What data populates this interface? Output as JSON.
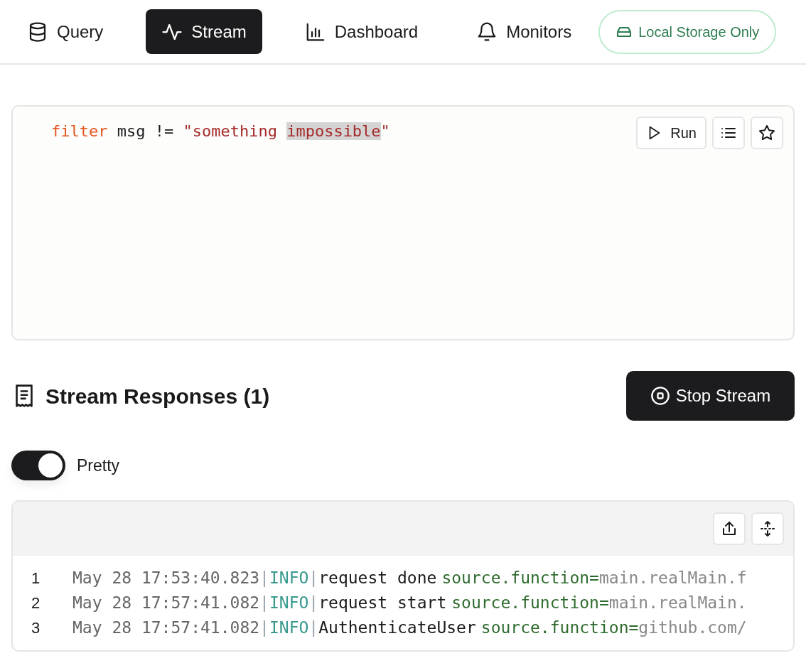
{
  "nav": {
    "tabs": [
      {
        "label": "Query",
        "kind": "database",
        "selected": false
      },
      {
        "label": "Stream",
        "kind": "pulse",
        "selected": true
      },
      {
        "label": "Dashboard",
        "kind": "chart",
        "selected": false
      },
      {
        "label": "Monitors",
        "kind": "bell",
        "selected": false
      }
    ],
    "storage_badge": "Local Storage Only"
  },
  "editor": {
    "tokens": [
      {
        "text": "filter",
        "kind": "keyword",
        "highlighted": false
      },
      {
        "text": " msg != ",
        "kind": "plain",
        "highlighted": false
      },
      {
        "text": "\"something ",
        "kind": "string",
        "highlighted": false
      },
      {
        "text": "impossible",
        "kind": "string",
        "highlighted": true
      },
      {
        "text": "\"",
        "kind": "string",
        "highlighted": false
      }
    ],
    "run_button": "Run"
  },
  "responses": {
    "title": "Stream Responses (1)",
    "stop_button": "Stop Stream",
    "pretty_toggle": {
      "label": "Pretty",
      "on": true
    }
  },
  "log": {
    "lines": [
      {
        "number": "1",
        "timestamp": "May 28 17:53:40.823",
        "separator_1": "|",
        "level": "INFO",
        "separator_2": "|",
        "message": "request done",
        "field_key": "source.function=",
        "field_value": "main.realMain.f"
      },
      {
        "number": "2",
        "timestamp": "May 28 17:57:41.082",
        "separator_1": "|",
        "level": "INFO",
        "separator_2": "|",
        "message": "request start",
        "field_key": "source.function=",
        "field_value": "main.realMain."
      },
      {
        "number": "3",
        "timestamp": "May 28 17:57:41.082",
        "separator_1": "|",
        "level": "INFO",
        "separator_2": "|",
        "message": "AuthenticateUser",
        "field_key": "source.function=",
        "field_value": "github.com/"
      }
    ]
  }
}
